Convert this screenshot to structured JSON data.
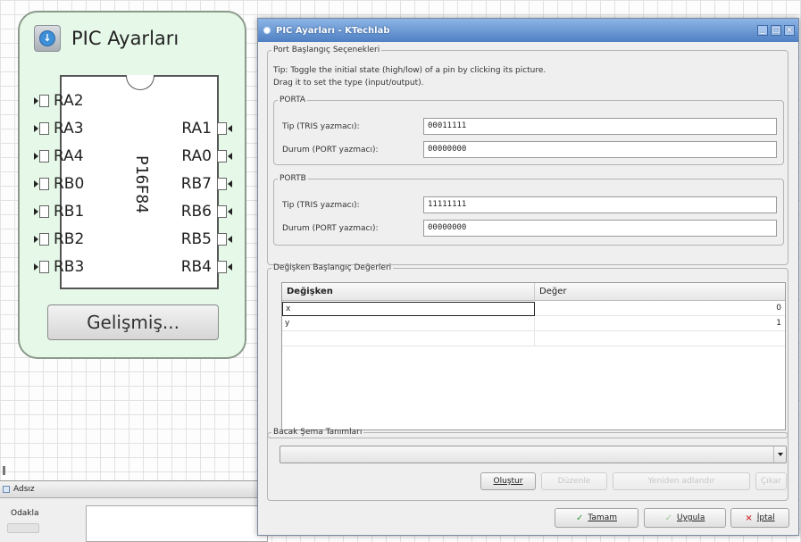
{
  "canvas": {
    "pic": {
      "title": "PIC Ayarları",
      "chip_name": "P16F84",
      "left_pins": [
        "RA2",
        "RA3",
        "RA4",
        "RB0",
        "RB1",
        "RB2",
        "RB3"
      ],
      "right_pins": [
        "RA1",
        "RA0",
        "RB7",
        "RB6",
        "RB5",
        "RB4"
      ],
      "advanced_button": "Gelişmiş..."
    }
  },
  "dock": {
    "tab_label": "Adsız",
    "zoom_label": "Odakla"
  },
  "dialog": {
    "title": "PIC Ayarları - KTechlab",
    "port_group": {
      "title": "Port Başlangıç Seçenekleri",
      "tip_line1": "Tip: Toggle the initial state (high/low) of a pin by clicking its picture.",
      "tip_line2": "Drag it to set the type (input/output).",
      "porta": {
        "title": "PORTA",
        "tris_label": "Tip (TRIS yazmacı):",
        "tris_value": "00011111",
        "port_label": "Durum (PORT yazmacı):",
        "port_value": "00000000"
      },
      "portb": {
        "title": "PORTB",
        "tris_label": "Tip (TRIS yazmacı):",
        "tris_value": "11111111",
        "port_label": "Durum (PORT yazmacı):",
        "port_value": "00000000"
      }
    },
    "vars_group": {
      "title": "Değişken Başlangıç Değerleri",
      "columns": [
        "Değişken",
        "Değer"
      ],
      "rows": [
        {
          "name": "x",
          "value": "0"
        },
        {
          "name": "y",
          "value": "1"
        }
      ]
    },
    "pin_map_group": {
      "title": "Bacak Şema Tanımları",
      "selected": "",
      "buttons": {
        "create": "Oluştur",
        "edit": "Düzenle",
        "rename": "Yeniden adlandır",
        "remove": "Çıkar"
      }
    },
    "footer": {
      "ok": "Tamam",
      "apply": "Uygula",
      "cancel": "İptal"
    }
  }
}
